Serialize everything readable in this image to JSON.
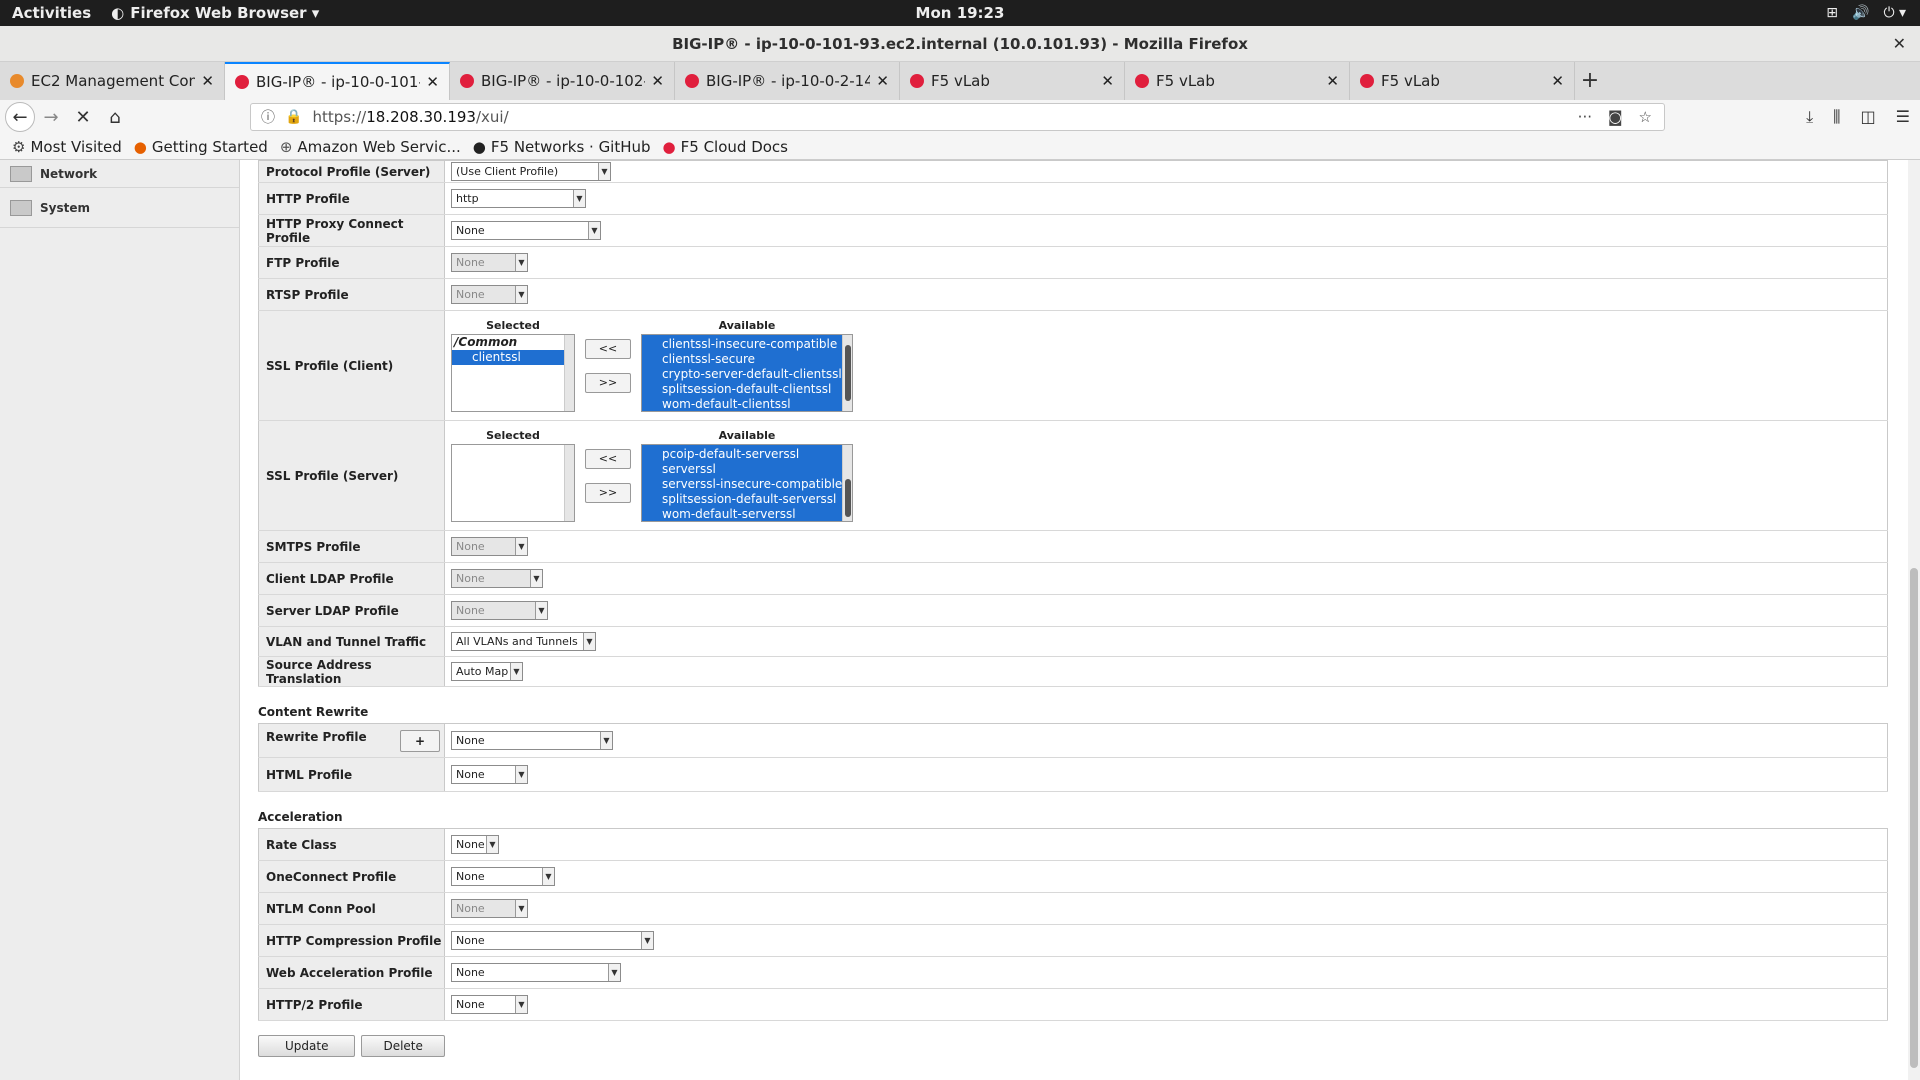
{
  "topbar": {
    "activities": "Activities",
    "app": "Firefox Web Browser ▾",
    "clock": "Mon 19:23"
  },
  "window": {
    "title": "BIG-IP® - ip-10-0-101-93.ec2.internal (10.0.101.93) - Mozilla Firefox"
  },
  "tabs": [
    {
      "label": "EC2 Management Con",
      "color": "#e88a2c"
    },
    {
      "label": "BIG-IP® - ip-10-0-101-",
      "color": "#e01f3d",
      "active": true
    },
    {
      "label": "BIG-IP® - ip-10-0-102-",
      "color": "#e01f3d"
    },
    {
      "label": "BIG-IP® - ip-10-0-2-14",
      "color": "#e01f3d"
    },
    {
      "label": "F5 vLab",
      "color": "#e01f3d"
    },
    {
      "label": "F5 vLab",
      "color": "#e01f3d"
    },
    {
      "label": "F5 vLab",
      "color": "#e01f3d"
    }
  ],
  "url": {
    "prefix": "https://",
    "host": "18.208.30.193",
    "path": "/xui/"
  },
  "bookmarks": [
    "Most Visited",
    "Getting Started",
    "Amazon Web Servic...",
    "F5 Networks · GitHub",
    "F5 Cloud Docs"
  ],
  "leftnav": [
    "Network",
    "System"
  ],
  "rows1": [
    {
      "label": "Protocol Profile (Server)",
      "value": "(Use Client Profile)",
      "w": 160,
      "dis": false
    },
    {
      "label": "HTTP Profile",
      "value": "http",
      "w": 135,
      "dis": false
    },
    {
      "label": "HTTP Proxy Connect Profile",
      "value": "None",
      "w": 150,
      "dis": false
    },
    {
      "label": "FTP Profile",
      "value": "None",
      "w": 77,
      "dis": true
    },
    {
      "label": "RTSP Profile",
      "value": "None",
      "w": 77,
      "dis": true
    }
  ],
  "ssl_client": {
    "label": "SSL Profile (Client)",
    "selected_header": "Selected",
    "available_header": "Available",
    "group": "/Common",
    "selected": [
      "clientssl"
    ],
    "available": [
      "clientssl-insecure-compatible",
      "clientssl-secure",
      "crypto-server-default-clientssl",
      "splitsession-default-clientssl",
      "wom-default-clientssl"
    ]
  },
  "ssl_server": {
    "label": "SSL Profile (Server)",
    "selected_header": "Selected",
    "available_header": "Available",
    "available": [
      "pcoip-default-serverssl",
      "serverssl",
      "serverssl-insecure-compatible",
      "splitsession-default-serverssl",
      "wom-default-serverssl"
    ]
  },
  "move_left": "<<",
  "move_right": ">>",
  "rows2": [
    {
      "label": "SMTPS Profile",
      "value": "None",
      "w": 77,
      "dis": true
    },
    {
      "label": "Client LDAP Profile",
      "value": "None",
      "w": 92,
      "dis": true
    },
    {
      "label": "Server LDAP Profile",
      "value": "None",
      "w": 97,
      "dis": true
    },
    {
      "label": "VLAN and Tunnel Traffic",
      "value": "All VLANs and Tunnels",
      "w": 145,
      "dis": false
    },
    {
      "label": "Source Address Translation",
      "value": "Auto Map",
      "w": 72,
      "dis": false
    }
  ],
  "content_rewrite": {
    "title": "Content Rewrite",
    "rows": [
      {
        "label": "Rewrite Profile",
        "value": "None",
        "w": 162,
        "plus": "+"
      },
      {
        "label": "HTML Profile",
        "value": "None",
        "w": 77
      }
    ]
  },
  "acceleration": {
    "title": "Acceleration",
    "rows": [
      {
        "label": "Rate Class",
        "value": "None",
        "w": 48,
        "dis": false
      },
      {
        "label": "OneConnect Profile",
        "value": "None",
        "w": 104,
        "dis": false
      },
      {
        "label": "NTLM Conn Pool",
        "value": "None",
        "w": 77,
        "dis": true
      },
      {
        "label": "HTTP Compression Profile",
        "value": "None",
        "w": 203,
        "dis": false
      },
      {
        "label": "Web Acceleration Profile",
        "value": "None",
        "w": 170,
        "dis": false
      },
      {
        "label": "HTTP/2 Profile",
        "value": "None",
        "w": 77,
        "dis": false
      }
    ]
  },
  "buttons": {
    "update": "Update",
    "delete": "Delete"
  }
}
